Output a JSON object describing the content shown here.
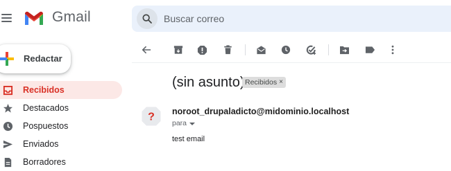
{
  "header": {
    "brand": "Gmail",
    "search": {
      "placeholder": "Buscar correo"
    }
  },
  "sidebar": {
    "compose_label": "Redactar",
    "items": [
      {
        "label": "Recibidos",
        "icon": "inbox-icon",
        "active": true
      },
      {
        "label": "Destacados",
        "icon": "star-icon",
        "active": false
      },
      {
        "label": "Pospuestos",
        "icon": "clock-icon",
        "active": false
      },
      {
        "label": "Enviados",
        "icon": "send-icon",
        "active": false
      },
      {
        "label": "Borradores",
        "icon": "draft-icon",
        "active": false
      }
    ]
  },
  "toolbar": {
    "icons": [
      "back-arrow-icon",
      "archive-icon",
      "report-spam-icon",
      "delete-icon",
      "mark-unread-icon",
      "snooze-icon",
      "add-task-icon",
      "move-to-icon",
      "label-icon",
      "more-vert-icon"
    ]
  },
  "message": {
    "subject": "(sin asunto)",
    "label_chip": "Recibidos",
    "chip_remove": "×",
    "sender": "noroot_drupaladicto@midominio.localhost",
    "recipient_label": "para",
    "body": "test email"
  },
  "colors": {
    "accent_red": "#d93025",
    "active_bg": "#fce8e6",
    "search_bg": "#eaf1fb",
    "icon_grey": "#5f6368"
  }
}
